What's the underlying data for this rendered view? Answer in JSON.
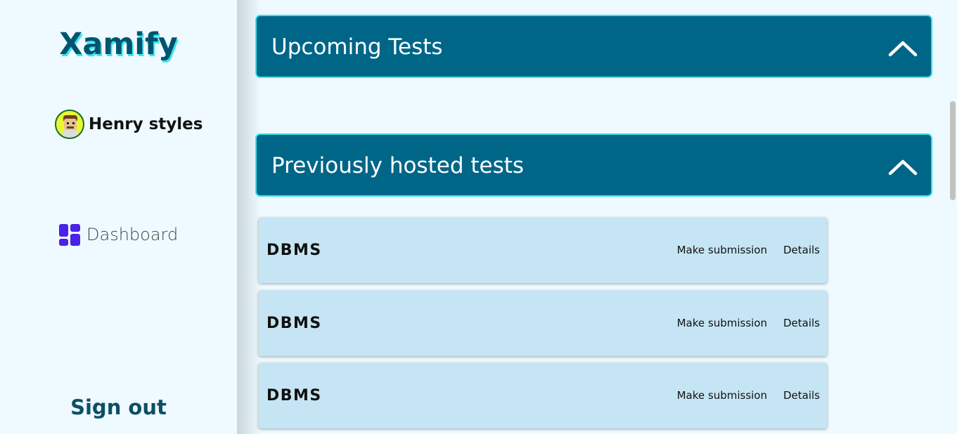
{
  "sidebar": {
    "logo": "Xamify",
    "user": {
      "name": "Henry styles"
    },
    "nav": [
      {
        "label": "Dashboard",
        "icon": "dashboard-icon"
      }
    ],
    "signout_label": "Sign out"
  },
  "main": {
    "sections": [
      {
        "title": "Upcoming Tests",
        "icon": "chevron-up-icon"
      },
      {
        "title": "Previously hosted tests",
        "icon": "chevron-up-icon"
      }
    ],
    "tests": [
      {
        "name": "DBMS",
        "submit_label": "Make submission",
        "details_label": "Details"
      },
      {
        "name": "DBMS",
        "submit_label": "Make submission",
        "details_label": "Details"
      },
      {
        "name": "DBMS",
        "submit_label": "Make submission",
        "details_label": "Details"
      }
    ]
  },
  "colors": {
    "accent": "#006688",
    "border": "#33e3ef",
    "card": "#c6e5f4",
    "icon": "#4b22e6"
  }
}
